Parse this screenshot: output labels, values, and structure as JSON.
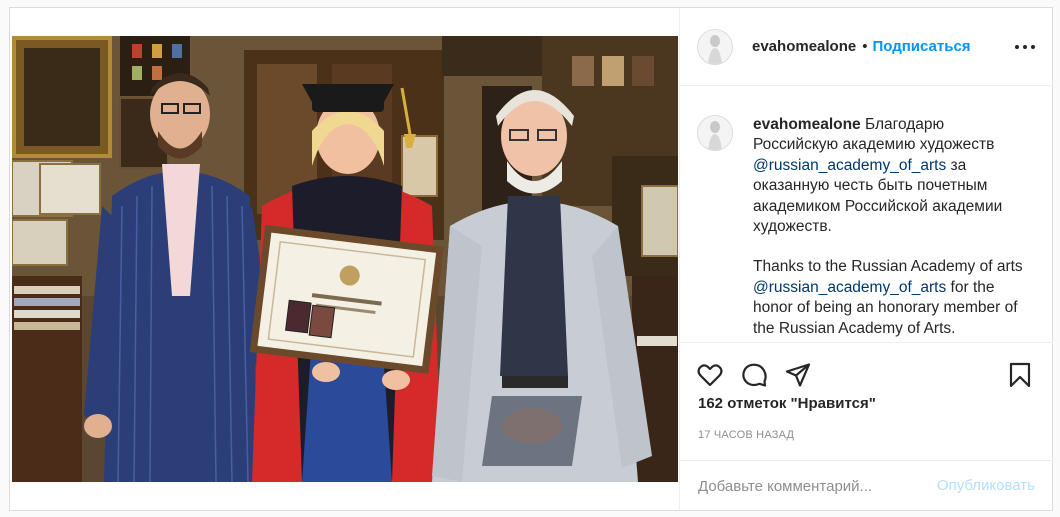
{
  "post": {
    "username": "evahomealone",
    "separator": "•",
    "follow_label": "Подписаться",
    "more_icon": "more-options-icon",
    "image_alt": ""
  },
  "caption": {
    "username": "evahomealone",
    "line_ru_1": "Благодарю Российскую академию художеств",
    "mention_1": "@russian_academy_of_arts",
    "line_ru_2": "за оказанную честь быть почетным академиком Российской академии художеств.",
    "line_en_1": "Thanks to the Russian Academy of arts",
    "mention_2": "@russian_academy_of_arts",
    "line_en_2": "for the honor of being an honorary member of the Russian Academy of Arts."
  },
  "actions": {
    "like_icon": "heart-icon",
    "comment_icon": "comment-icon",
    "share_icon": "paper-plane-icon",
    "save_icon": "bookmark-icon",
    "likes_text": "162 отметок \"Нравится\"",
    "time_text": "17 часов назад"
  },
  "comment": {
    "placeholder": "Добавьте комментарий...",
    "post_label": "Опубликовать"
  },
  "colors": {
    "accent": "#0095f6",
    "post_disabled": "#b2dffc",
    "mention": "#00376b",
    "muted": "#8e8e8e"
  }
}
